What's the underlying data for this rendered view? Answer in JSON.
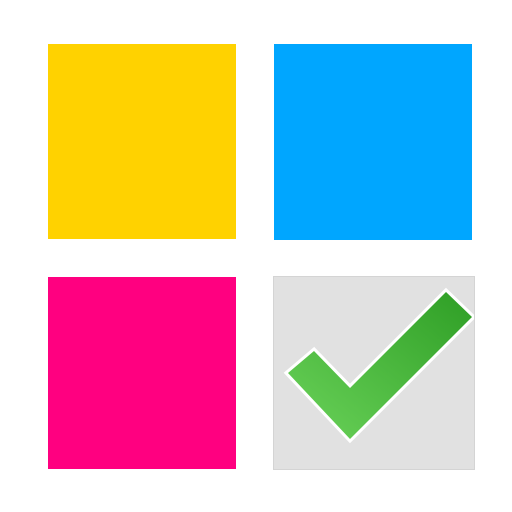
{
  "tiles": [
    {
      "name": "yellow-tile",
      "color": "#FFD200"
    },
    {
      "name": "blue-tile",
      "color": "#00A6FF"
    },
    {
      "name": "pink-tile",
      "color": "#FF0080"
    },
    {
      "name": "check-tile",
      "color": "#E1E1E1"
    }
  ],
  "checkmark": {
    "icon": "checkmark-icon",
    "color_light": "#6BD35A",
    "color_dark": "#2E9E25",
    "outline": "#FFFFFF"
  }
}
